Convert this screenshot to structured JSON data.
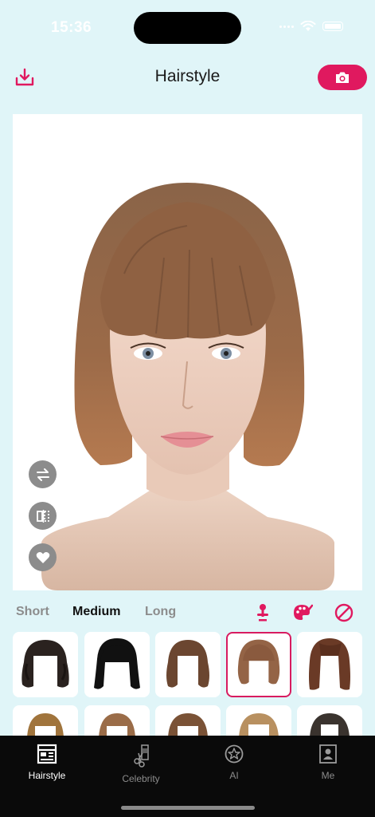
{
  "status": {
    "time": "15:36"
  },
  "header": {
    "title": "Hairstyle"
  },
  "tabs": [
    {
      "label": "Short",
      "active": false
    },
    {
      "label": "Medium",
      "active": true
    },
    {
      "label": "Long",
      "active": false
    }
  ],
  "tools": [
    "pin-icon",
    "palette-icon",
    "none-icon"
  ],
  "side_buttons": [
    "swap-icon",
    "mirror-icon",
    "heart-icon"
  ],
  "hairstyles": {
    "row1": [
      "Curly dark medium",
      "Black bob with bangs",
      "Brown wavy medium",
      "Brown bob with bangs",
      "Auburn straight medium"
    ],
    "row2": [
      "Blonde medium",
      "Light brown medium",
      "Brown medium",
      "Blonde shag",
      "Dark straight medium"
    ],
    "selected_index": 3
  },
  "tabbar": [
    {
      "label": "Hairstyle",
      "icon": "hairstyle-icon",
      "active": true
    },
    {
      "label": "Celebrity",
      "icon": "celebrity-icon",
      "active": false
    },
    {
      "label": "AI",
      "icon": "ai-icon",
      "active": false
    },
    {
      "label": "Me",
      "icon": "me-icon",
      "active": false
    }
  ],
  "colors": {
    "accent": "#e0195f",
    "background": "#e0f5f8",
    "tabbar": "#0a0a0a"
  }
}
